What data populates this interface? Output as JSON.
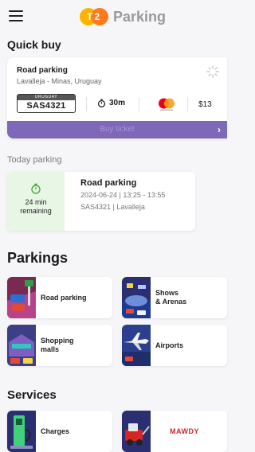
{
  "header": {
    "logo_mark": "T2",
    "app_name": "Parking",
    "colors": {
      "logo_yellow": "#ffb300",
      "logo_orange": "#ff7a1a"
    }
  },
  "quick_buy": {
    "title": "Quick buy",
    "card": {
      "name": "Road parking",
      "location": "Lavalleja - Minas, Uruguay",
      "plate_country": "URUGUAY",
      "plate_number": "SAS4321",
      "duration": "30m",
      "payment_icon": "mastercard-icon",
      "price": "$13",
      "buy_label": "Buy ticket",
      "buy_color": "#7e68b8"
    }
  },
  "today_parking": {
    "title": "Today parking",
    "remaining": "24 min remaining",
    "remaining_line1": "24 min",
    "remaining_line2": "remaining",
    "name": "Road parking",
    "time": "2024-06-24 | 13:25 - 13:55",
    "plate_location": "SAS4321 | Lavalleja",
    "status_color": "#e8f6e6"
  },
  "parkings": {
    "title": "Parkings",
    "items": [
      {
        "label": "Road parking",
        "icon": "road-parking-icon"
      },
      {
        "label_line1": "Shows",
        "label_line2": "& Arenas",
        "icon": "arena-icon"
      },
      {
        "label_line1": "Shopping",
        "label_line2": "malls",
        "icon": "shopping-mall-icon"
      },
      {
        "label": "Airports",
        "icon": "airport-icon"
      }
    ]
  },
  "services": {
    "title": "Services",
    "items": [
      {
        "label": "Charges",
        "icon": "ev-charger-icon"
      },
      {
        "label": "MAWDY",
        "icon": "tow-truck-icon"
      }
    ]
  }
}
